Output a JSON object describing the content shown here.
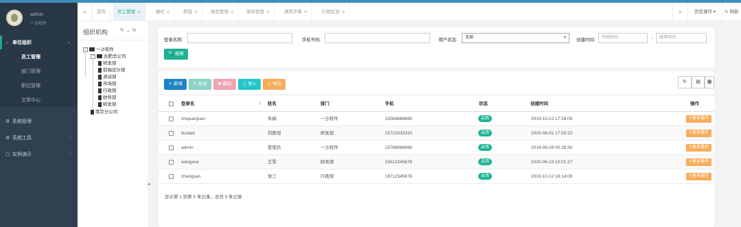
{
  "profile": {
    "name": "admin",
    "role": "一沙软件"
  },
  "sidebar": {
    "groups": [
      {
        "label": "单位组织",
        "icon": "home-icon",
        "items": [
          "员工管理",
          "部门管理",
          "职位管理",
          "文章中心"
        ]
      },
      {
        "label": "系统管理",
        "icon": "gear-icon"
      },
      {
        "label": "系统工具",
        "icon": "gears-icon"
      },
      {
        "label": "实例演示",
        "icon": "square-icon"
      }
    ]
  },
  "tabs": {
    "items": [
      "首页",
      "员工管理",
      "栅栏",
      "按钮",
      "角色管理",
      "菜单管理",
      "通用字典",
      "行政区划"
    ],
    "page_op": "页签操作",
    "refresh": "刷新"
  },
  "org": {
    "title": "组织机构",
    "tree": {
      "root": "一沙软件",
      "branch": "合肥总公司",
      "departments": [
        "研发部",
        "前端设计部",
        "测试部",
        "市场部",
        "行政部",
        "财务部",
        "研发部"
      ],
      "other": "南京分公司"
    }
  },
  "search": {
    "login_label": "登录名称:",
    "phone_label": "手机号码:",
    "status_label": "用户状态:",
    "status_value": "全部",
    "time_label": "创建时间:",
    "start_placeholder": "开始时间",
    "sep": "-",
    "end_placeholder": "结束时间",
    "button": "搜索"
  },
  "toolbar": {
    "add": "新增",
    "edit": "修改",
    "delete": "删除",
    "import": "导入",
    "export": "导出"
  },
  "table": {
    "columns": [
      "登录名",
      "姓名",
      "部门",
      "手机",
      "状态",
      "创建时间",
      "操作"
    ],
    "rows": [
      {
        "login": "zhujuanjuan",
        "name": "朱娟",
        "dept": "一沙软件",
        "phone": "15566666666",
        "status": "启用",
        "created": "2019-10-12 17:26:05",
        "op": "更多操作"
      },
      {
        "login": "liusitan",
        "name": "刘斯坦",
        "dept": "研发部",
        "phone": "15733333333",
        "status": "启用",
        "created": "2020-08-02 17:55:22",
        "op": "更多操作"
      },
      {
        "login": "admin",
        "name": "管理员",
        "dept": "一沙软件",
        "phone": "15766666666",
        "status": "启用",
        "created": "2019-09-28 00:28:30",
        "op": "更多操作"
      },
      {
        "login": "wangxue",
        "name": "王雪",
        "dept": "财务部",
        "phone": "15612345678",
        "status": "启用",
        "created": "2020-06-23 10:01:27",
        "op": "更多操作"
      },
      {
        "login": "zhangsan",
        "name": "张三",
        "dept": "行政部",
        "phone": "18712345678",
        "status": "启用",
        "created": "2019-10-12 18:14:09",
        "op": "更多操作"
      }
    ],
    "pageinfo": "显示第 1 到第 5 条记录，总共 5 条记录"
  },
  "colors": {
    "accent": "#1ab394",
    "sidebar": "#2f4050",
    "warning": "#f8ac59",
    "primary": "#1c84c6"
  }
}
